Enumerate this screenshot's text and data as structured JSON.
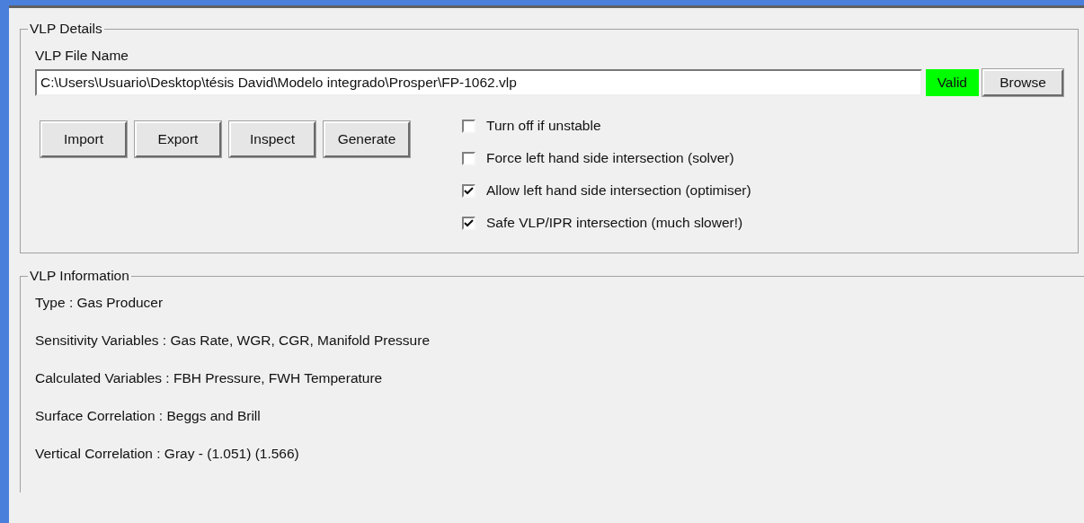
{
  "details": {
    "legend": "VLP Details",
    "file_label": "VLP File Name",
    "file_value": "C:\\Users\\Usuario\\Desktop\\tésis David\\Modelo integrado\\Prosper\\FP-1062.vlp",
    "status": "Valid",
    "valid": true,
    "browse": "Browse",
    "buttons": [
      "Import",
      "Export",
      "Inspect",
      "Generate"
    ],
    "options": [
      {
        "label": "Turn off if unstable",
        "checked": false
      },
      {
        "label": "Force left hand side intersection (solver)",
        "checked": false
      },
      {
        "label": "Allow left hand side intersection (optimiser)",
        "checked": true
      },
      {
        "label": "Safe VLP/IPR intersection (much slower!)",
        "checked": true
      }
    ]
  },
  "information": {
    "legend": "VLP Information",
    "lines": [
      "Type : Gas Producer",
      "Sensitivity Variables : Gas Rate, WGR, CGR, Manifold Pressure",
      "Calculated Variables : FBH Pressure, FWH Temperature",
      "Surface Correlation : Beggs and Brill",
      "Vertical Correlation : Gray - (1.051) (1.566)"
    ]
  }
}
